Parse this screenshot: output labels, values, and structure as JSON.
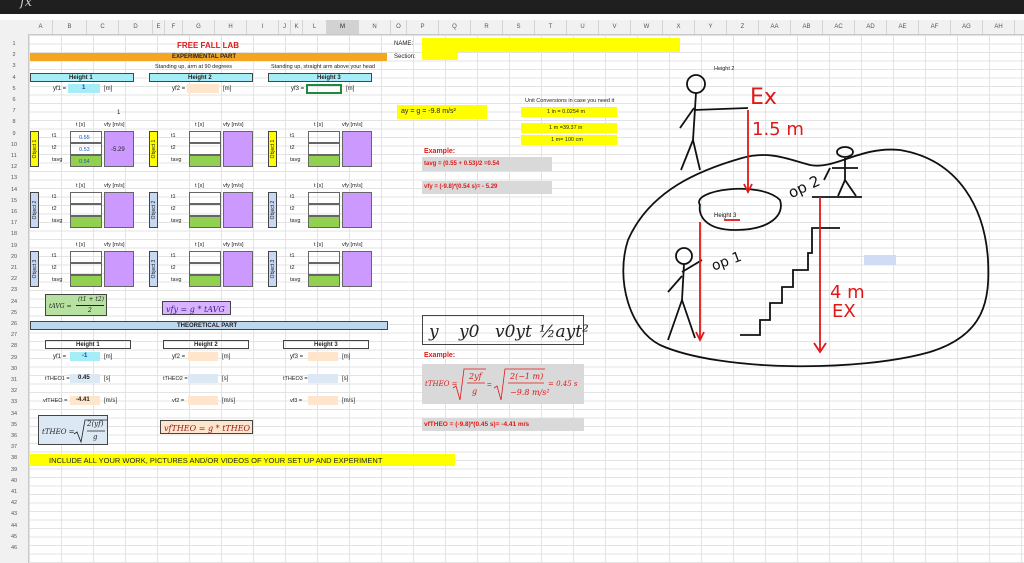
{
  "formula_bar": {
    "fx": "fx"
  },
  "columns": [
    "A",
    "B",
    "C",
    "D",
    "E",
    "F",
    "G",
    "H",
    "I",
    "J",
    "K",
    "L",
    "M",
    "N",
    "O",
    "P",
    "Q",
    "R",
    "S",
    "T",
    "U",
    "V",
    "W",
    "X",
    "Y",
    "Z",
    "AA",
    "AB",
    "AC",
    "AD",
    "AE",
    "AF",
    "AG",
    "AH",
    "AI"
  ],
  "rows": [
    "1",
    "2",
    "3",
    "4",
    "5",
    "6",
    "7",
    "8",
    "9",
    "10",
    "11",
    "12",
    "13",
    "14",
    "15",
    "16",
    "17",
    "18",
    "19",
    "20",
    "21",
    "22",
    "23",
    "24",
    "25",
    "26",
    "27",
    "28",
    "29",
    "30",
    "31",
    "32",
    "33",
    "34",
    "35",
    "36",
    "37",
    "38",
    "39",
    "40",
    "41",
    "42",
    "43",
    "44",
    "45",
    "46"
  ],
  "sheet": {
    "title": "FREE FALL LAB",
    "exp_part": "EXPERIMENTAL PART",
    "standing1": "Standing up, arm at 90 degrees",
    "standing2": "Standing up, straight arm above your head",
    "name_label": "NAME:",
    "section_label": "Section:",
    "heights": [
      "Height 1",
      "Height 2",
      "Height 3"
    ],
    "yf1": "yf1 =",
    "yf1_value": "1",
    "yf2": "yf2 =",
    "yf3": "yf3 =",
    "unit_m": "[m]",
    "cell_h7": "1",
    "t_s": "t [s]",
    "vfy": "vfy [m/s]",
    "t1": "t1",
    "t2": "t2",
    "tavg": "tavg",
    "obj1_t1": "0.55",
    "obj1_t2": "0.53",
    "obj1_avg": "0.54",
    "obj1_v": "-5.29",
    "objects": [
      "Object 1",
      "Object 2",
      "Object 3"
    ],
    "ay": "ay = g = -9.8 m/s²",
    "unit_conv_title": "Unit Conversions in case you need it",
    "conv1": "1 in = 0.0254 m",
    "conv2": "1 m =39.37 in",
    "conv3": "1 m= 100 cm",
    "example": "Example:",
    "ex_tavg": "tavg = (0.55 + 0.53)/2 =0.54",
    "ex_vfy": "vfy = (-9.8)*(0.54 s)= - 5.29",
    "tavg_formula_lhs": "tAVG =",
    "tavg_formula_num": "(t1 + t2)",
    "tavg_formula_den": "2",
    "vfy_formula": "vfy = g * tAVG",
    "theo_part": "THEORETICAL PART",
    "th_yf1_value": "-1",
    "theo_label1": "tTHEO1 =",
    "theo_label2": "tTHEO2 =",
    "theo_label3": "tTHEO3 =",
    "theo1_value": "0.45",
    "unit_s": "[s]",
    "vth_label1": "vfTHEO =",
    "vth_label2": "vf2 =",
    "vth_label3": "vf3 =",
    "vth1_value": "-4.41",
    "unit_ms": "[m/s]",
    "kin_vars": [
      "y",
      "y0",
      "v0yt",
      "½ayt²"
    ],
    "example2": "Example:",
    "ex_theo_lhs": "tTHEO =",
    "ex_theo_result": "= 0.45 s",
    "ex_vtheo": "vfTHEO = (-9.8)*(0.45 s)= -4.41 m/s",
    "ttheo_formula_lhs": "tTHEO =",
    "ttheo_formula_num": "2(yf)",
    "ttheo_formula_den": "g",
    "vftheo_formula": "vfTHEO = g * tTHEO",
    "include": "INCLUDE ALL YOUR WORK, PICTURES AND/OR VIDEOS OF YOUR SET UP AND EXPERIMENT",
    "drawing_height2": "Height 2",
    "drawing_height3": "Height 3",
    "ann_ex1": "Ex",
    "ann_15m": "1.5 m",
    "ann_op2": "op 2",
    "ann_op1": "op 1",
    "ann_4m": "4 m",
    "ann_ex2": "EX"
  },
  "colors": {
    "cyan": "#a6eef7",
    "orange": "#f4a622",
    "yellow": "#ffff00",
    "green": "#92d050",
    "purple": "#cc99ff",
    "red": "#e11818"
  }
}
